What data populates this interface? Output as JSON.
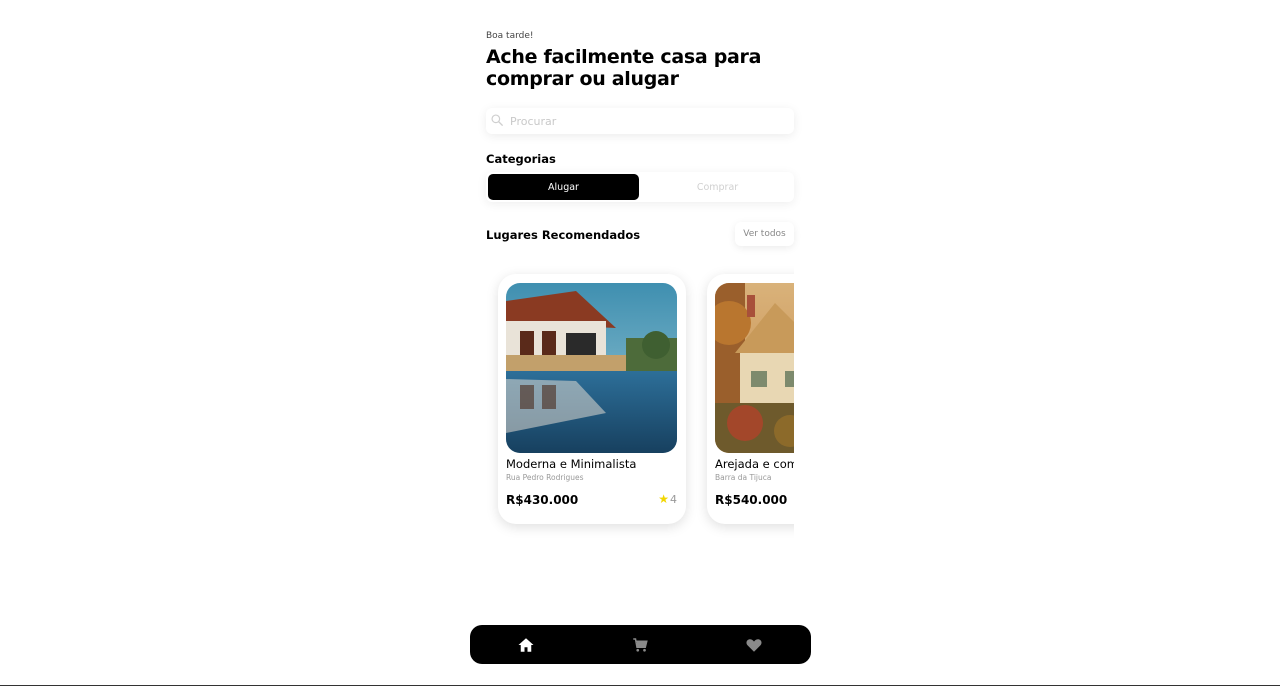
{
  "greeting": "Boa tarde!",
  "headline": "Ache facilmente casa para comprar ou alugar",
  "search": {
    "placeholder": "Procurar",
    "icon": "search-icon"
  },
  "categories": {
    "title": "Categorias",
    "options": [
      {
        "label": "Alugar",
        "active": true
      },
      {
        "label": "Comprar",
        "active": false
      }
    ]
  },
  "recommended": {
    "title": "Lugares Recomendados",
    "see_all": "Ver todos",
    "cards": [
      {
        "title": "Moderna e Minimalista",
        "address": "Rua Pedro Rodrigues",
        "price": "R$430.000",
        "rating": "4"
      },
      {
        "title": "Arejada e com",
        "address": "Barra da Tijuca",
        "price": "R$540.000"
      }
    ]
  },
  "nav": {
    "items": [
      {
        "icon": "home-icon",
        "active": true
      },
      {
        "icon": "cart-icon",
        "active": false
      },
      {
        "icon": "heart-icon",
        "active": false
      }
    ]
  },
  "colors": {
    "primary": "#000000",
    "star": "#f2d600",
    "muted": "#999999"
  }
}
